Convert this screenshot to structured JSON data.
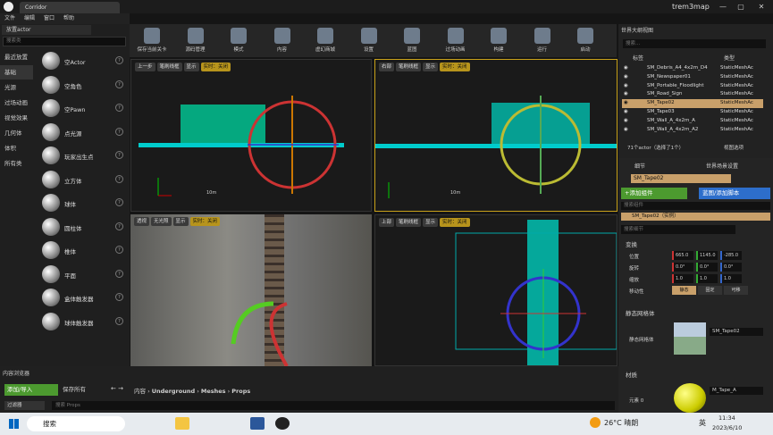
{
  "titlebar": {
    "menu": [
      "文件",
      "编辑",
      "窗口",
      "帮助"
    ],
    "tab_label": "Corridor",
    "project": "trem3map",
    "win_min": "—",
    "win_max": "▢",
    "win_close": "✕"
  },
  "modes": {
    "tab_title": "放置actor",
    "search_placeholder": "搜索类",
    "categories": [
      "最近放置",
      "基础",
      "光源",
      "过场动画",
      "视觉效果",
      "几何体",
      "体积",
      "所有类"
    ],
    "selected_category": "基础",
    "items": [
      "空Actor",
      "空角色",
      "空Pawn",
      "点光源",
      "玩家出生点",
      "立方体",
      "球体",
      "圆柱体",
      "椎体",
      "平面",
      "盒体触发器",
      "球体触发器"
    ]
  },
  "toolbar": [
    "保存当前关卡",
    "源码管理",
    "模式",
    "内容",
    "虚幻商城",
    "设置",
    "蓝图",
    "过场动画",
    "构建",
    "运行",
    "启动"
  ],
  "viewports": {
    "tl": {
      "view": "上一步",
      "mode": "笔刷线框",
      "show": "显示",
      "realtime": "实时：关闭",
      "scale": "10m"
    },
    "tr": {
      "view": "右部",
      "mode": "笔刷线框",
      "show": "显示",
      "realtime": "实时：关闭",
      "scale": "10m"
    },
    "bl": {
      "view": "透视",
      "mode": "无光照",
      "show": "显示",
      "realtime": "实时：关闭"
    },
    "br": {
      "view": "上部",
      "mode": "笔刷线框",
      "show": "显示",
      "realtime": "实时：关闭"
    }
  },
  "content_browser": {
    "tab": "内容浏览器",
    "add_import": "添加/导入",
    "save_all": "保存所有",
    "path": [
      "内容",
      "Underground",
      "Meshes",
      "Props"
    ],
    "filter": "过滤器",
    "search_placeholder": "搜索 Props"
  },
  "outliner": {
    "tab": "世界大纲视图",
    "search_placeholder": "搜索...",
    "col_label": "标签",
    "col_type": "类型",
    "rows": [
      [
        "SM_Debris_A4_4x2m_D4",
        "StaticMeshAc"
      ],
      [
        "SM_Newspaper01",
        "StaticMeshAc"
      ],
      [
        "SM_Portable_Floodlight",
        "StaticMeshAc"
      ],
      [
        "SM_Road_Sign",
        "StaticMeshAc"
      ],
      [
        "SM_Tape02",
        "StaticMeshAc"
      ],
      [
        "SM_Tape03",
        "StaticMeshAc"
      ],
      [
        "SM_Wall_A_4x2m_A",
        "StaticMeshAc"
      ],
      [
        "SM_Wall_A_4x2m_A2",
        "StaticMeshAc"
      ]
    ],
    "selected_row": 4,
    "status": "71个actor（选择了1个）",
    "view_options": "视图选项"
  },
  "details": {
    "tab1": "细节",
    "tab2": "世界场景设置",
    "name": "SM_Tape02",
    "add_component": "+添加组件",
    "blueprint_btn": "蓝图/添加脚本",
    "search_comp_placeholder": "搜索组件",
    "instance_row": "SM_Tape02（实例）",
    "search_detail_placeholder": "搜索细节",
    "transform_title": "变换",
    "loc_label": "位置",
    "loc": [
      "665.0",
      "1145.0",
      "-285.0"
    ],
    "rot_label": "旋转",
    "rot": [
      "0.0°",
      "0.0°",
      "0.0°"
    ],
    "scale_label": "缩放",
    "scale": [
      "1.0",
      "1.0",
      "1.0"
    ],
    "mobility_label": "移动性",
    "mobility": [
      "静态",
      "固定",
      "可移"
    ],
    "sm_title": "静态网格体",
    "sm_label": "静态网格体",
    "sm_value": "SM_Tape02",
    "mat_title": "材质",
    "elem_label": "元素 0",
    "mat_value": "M_Tape_A",
    "accent": "#c9a06a",
    "addbtn_color": "#4c9a2f",
    "bpbtn_color": "#2d6ecb"
  },
  "taskbar": {
    "search": "搜索",
    "weather": "26°C 晴朗",
    "ime": "英",
    "time": "11:34",
    "date": "2023/6/10"
  }
}
